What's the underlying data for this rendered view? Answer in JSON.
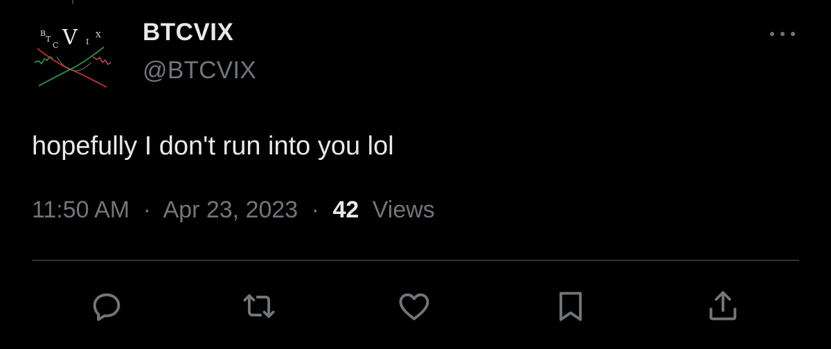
{
  "tweet": {
    "display_name": "BTCVIX",
    "handle": "@BTCVIX",
    "text": "hopefully I don't run into you lol",
    "time": "11:50 AM",
    "separator": "·",
    "date": "Apr 23, 2023",
    "views_count": "42",
    "views_label": "Views"
  },
  "avatar": {
    "letters": [
      "B",
      "T",
      "C",
      "V",
      "I",
      "X"
    ]
  },
  "actions": [
    {
      "name": "reply",
      "icon": "reply-icon"
    },
    {
      "name": "retweet",
      "icon": "retweet-icon"
    },
    {
      "name": "like",
      "icon": "heart-icon"
    },
    {
      "name": "bookmark",
      "icon": "bookmark-icon"
    },
    {
      "name": "share",
      "icon": "share-icon"
    }
  ],
  "colors": {
    "background": "#000000",
    "primary_text": "#e7e9ea",
    "secondary_text": "#71767b",
    "divider": "#2f3336"
  }
}
